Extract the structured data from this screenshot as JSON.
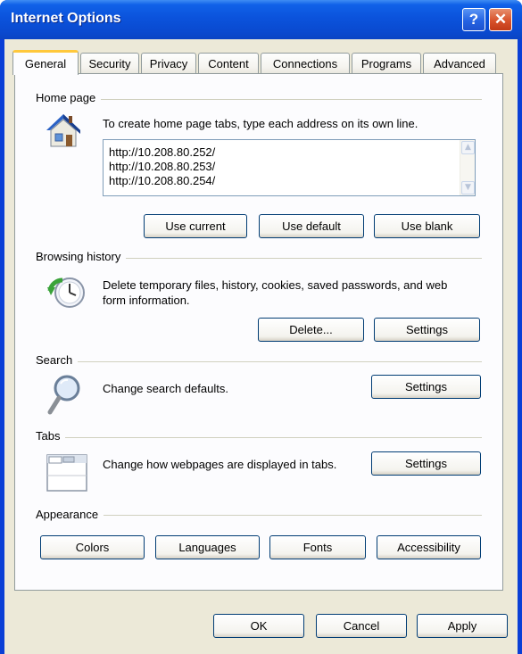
{
  "window": {
    "title": "Internet Options",
    "help_glyph": "?",
    "close_glyph": "✕"
  },
  "tabs": [
    {
      "label": "General",
      "active": true
    },
    {
      "label": "Security"
    },
    {
      "label": "Privacy"
    },
    {
      "label": "Content"
    },
    {
      "label": "Connections"
    },
    {
      "label": "Programs"
    },
    {
      "label": "Advanced"
    }
  ],
  "home_page": {
    "group_label": "Home page",
    "description": "To create home page tabs, type each address on its own line.",
    "urls": "http://10.208.80.252/\nhttp://10.208.80.253/\nhttp://10.208.80.254/",
    "use_current": "Use current",
    "use_default": "Use default",
    "use_blank": "Use blank",
    "icon": "house-icon"
  },
  "browsing_history": {
    "group_label": "Browsing history",
    "description": "Delete temporary files, history, cookies, saved passwords, and web form information.",
    "delete_button": "Delete...",
    "settings_button": "Settings",
    "icon": "history-clock-icon"
  },
  "search": {
    "group_label": "Search",
    "description": "Change search defaults.",
    "settings_button": "Settings",
    "icon": "magnifier-icon"
  },
  "tabs_section": {
    "group_label": "Tabs",
    "description": "Change how webpages are displayed in tabs.",
    "settings_button": "Settings",
    "icon": "tabs-window-icon"
  },
  "appearance": {
    "group_label": "Appearance",
    "colors": "Colors",
    "languages": "Languages",
    "fonts": "Fonts",
    "accessibility": "Accessibility"
  },
  "footer": {
    "ok": "OK",
    "cancel": "Cancel",
    "apply": "Apply"
  },
  "colors": {
    "titlebar": "#0a4ad0",
    "dialog_bg": "#ece9d8",
    "active_tab_accent": "#ffc83c"
  }
}
